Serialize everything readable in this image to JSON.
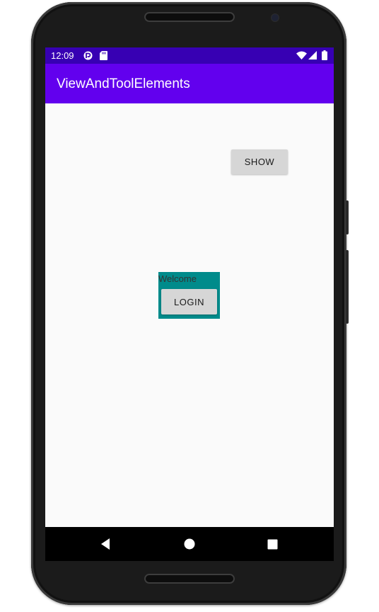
{
  "status_bar": {
    "time": "12:09",
    "icons": [
      "pocket-casts-icon",
      "sd-card-icon",
      "wifi-icon",
      "cellular-signal-icon",
      "battery-icon"
    ]
  },
  "app_bar": {
    "title": "ViewAndToolElements"
  },
  "content": {
    "show_button_label": "SHOW",
    "welcome_text": "Welcome",
    "login_button_label": "LOGIN"
  },
  "nav_bar": {
    "icons": [
      "back-icon",
      "home-icon",
      "recents-icon"
    ]
  },
  "colors": {
    "status_bar": "#3700b3",
    "app_bar": "#6200ee",
    "content_bg": "#fafafa",
    "login_panel": "#008b8b",
    "button_bg": "#d6d6d6"
  }
}
